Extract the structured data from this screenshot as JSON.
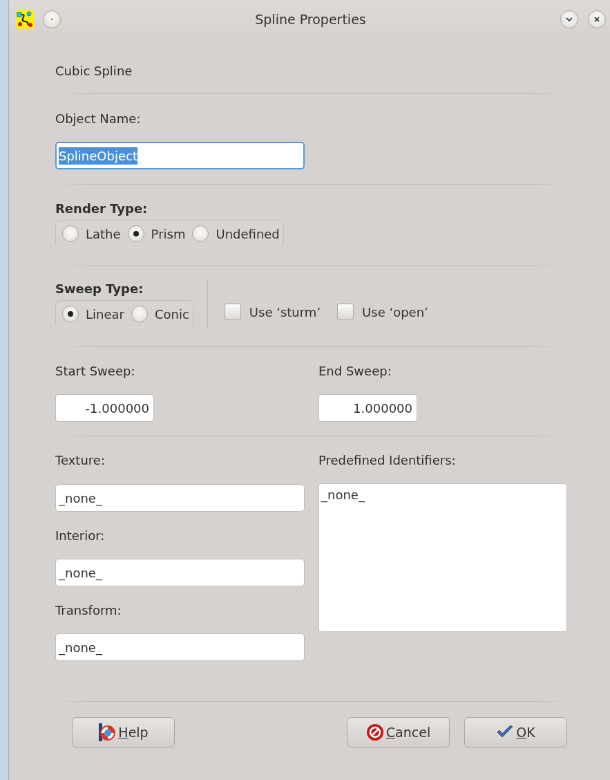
{
  "window": {
    "title": "Spline Properties"
  },
  "header": "Cubic Spline",
  "object_name": {
    "label": "Object Name:",
    "value": "SplineObject",
    "focused": true,
    "text_selected": true
  },
  "render_type": {
    "label": "Render Type:",
    "options": [
      {
        "label": "Lathe",
        "selected": false
      },
      {
        "label": "Prism",
        "selected": true
      },
      {
        "label": "Undefined",
        "selected": false
      }
    ]
  },
  "sweep_type": {
    "label": "Sweep Type:",
    "options": [
      {
        "label": "Linear",
        "selected": true
      },
      {
        "label": "Conic",
        "selected": false
      }
    ]
  },
  "checkboxes": [
    {
      "label": "Use ‘sturm’",
      "checked": false
    },
    {
      "label": "Use ‘open’",
      "checked": false
    }
  ],
  "start_sweep": {
    "label": "Start Sweep:",
    "value": "-1.000000"
  },
  "end_sweep": {
    "label": "End Sweep:",
    "value": "1.000000"
  },
  "texture": {
    "label": "Texture:",
    "value": "_none_"
  },
  "interior": {
    "label": "Interior:",
    "value": "_none_"
  },
  "transform": {
    "label": "Transform:",
    "value": "_none_"
  },
  "predefined_identifiers": {
    "label": "Predefined Identifiers:",
    "items": [
      {
        "label": "_none_",
        "selected": false
      }
    ]
  },
  "buttons": [
    {
      "kind": "help",
      "label": "Help",
      "mnemonic_underlined": true
    },
    {
      "kind": "cancel",
      "label": "Cancel",
      "mnemonic_underlined": true
    },
    {
      "kind": "ok",
      "label": "OK",
      "mnemonic_underlined": true
    }
  ]
}
